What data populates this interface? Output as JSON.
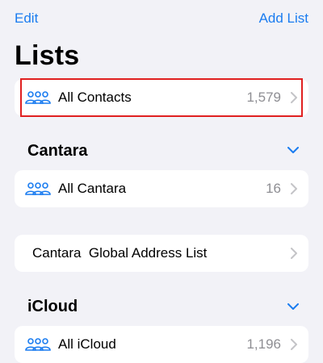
{
  "nav": {
    "edit_label": "Edit",
    "add_list_label": "Add List"
  },
  "page": {
    "title": "Lists"
  },
  "accent_color": "#1a7cf0",
  "highlight_color": "#e02020",
  "lists": {
    "all_contacts": {
      "label": "All Contacts",
      "count": "1,579",
      "icon": "people-group-icon"
    }
  },
  "sections": [
    {
      "title": "Cantara",
      "expanded": true,
      "items": [
        {
          "label": "All Cantara",
          "count": "16",
          "icon": "people-group-icon"
        },
        {
          "label": "Cantara  Global Address List",
          "count": "",
          "icon": ""
        }
      ]
    },
    {
      "title": "iCloud",
      "expanded": true,
      "items": [
        {
          "label": "All iCloud",
          "count": "1,196",
          "icon": "people-group-icon"
        }
      ]
    }
  ]
}
